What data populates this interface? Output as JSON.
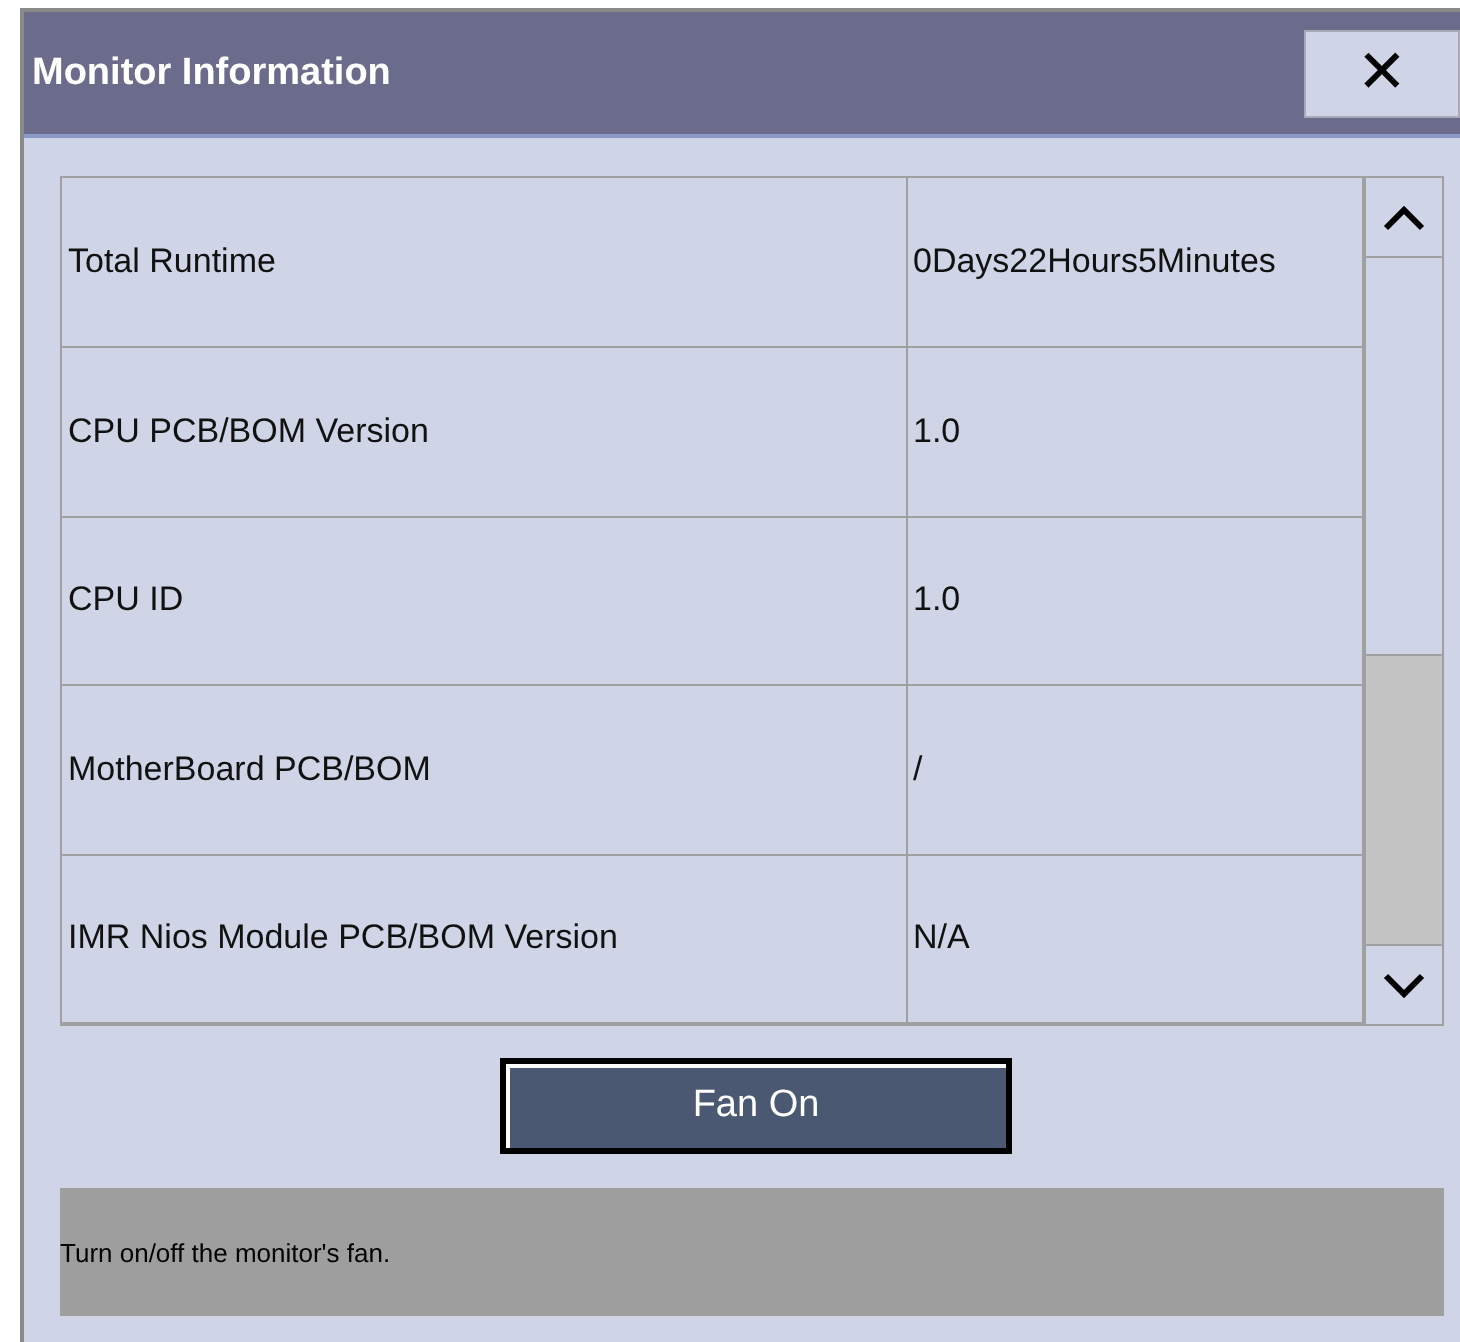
{
  "window": {
    "title": "Monitor Information",
    "close": "✕"
  },
  "table": {
    "rows": [
      {
        "label": "Total Runtime",
        "value": "0Days22Hours5Minutes"
      },
      {
        "label": "CPU PCB/BOM Version",
        "value": "1.0"
      },
      {
        "label": "CPU ID",
        "value": "1.0"
      },
      {
        "label": "MotherBoard PCB/BOM",
        "value": "/"
      },
      {
        "label": "IMR Nios Module PCB/BOM Version",
        "value": "N/A"
      }
    ]
  },
  "button": {
    "label": "Fan On"
  },
  "help_text": "Turn on/off the monitor's fan."
}
